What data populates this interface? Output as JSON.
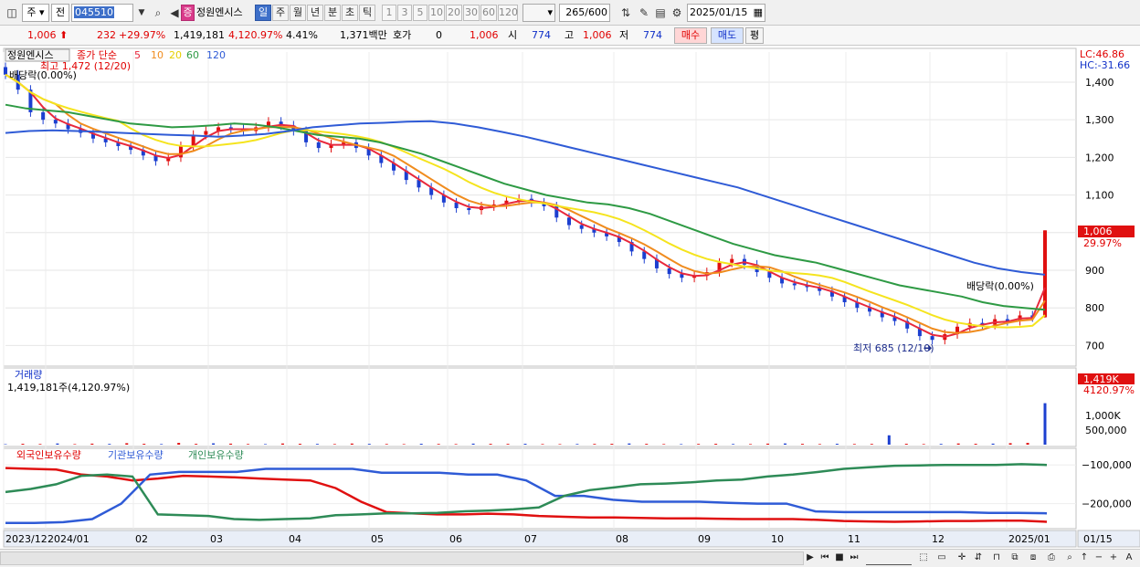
{
  "toolbar": {
    "market_dropdown": "주",
    "prev_dropdown": "전",
    "code_value": "045510",
    "stock_name": "정원엔시스",
    "badge": "증",
    "periods": [
      "일",
      "주",
      "월",
      "년",
      "분",
      "초",
      "틱"
    ],
    "active_period": "일",
    "intervals": [
      "1",
      "3",
      "5",
      "10",
      "20",
      "30",
      "60",
      "120"
    ],
    "count": "265",
    "count_total": "/600",
    "date": "2025/01/15"
  },
  "quote": {
    "price": "1,006",
    "change": "232",
    "change_rate": "+29.97%",
    "volume": "1,419,181",
    "volume_rate": "4,120.97%",
    "turnover_rate": "4.41%",
    "trade_value": "1,371백만",
    "hoga_label": "호가",
    "hoga_value": "0",
    "hoga_price": "1,006",
    "open_label": "시",
    "open": "774",
    "high_label": "고",
    "high": "1,006",
    "low_label": "저",
    "low": "774",
    "buy_label": "매수",
    "sell_label": "매도",
    "avg_label": "평"
  },
  "price_panel": {
    "title": "정원엔시스",
    "ma_label": "종가 단순",
    "ma_periods": [
      "5",
      "10",
      "20",
      "60",
      "120"
    ],
    "high_marker": "최고 1,472 (12/20)",
    "dividend_top": "배당락(0.00%)",
    "dividend_right": "배당락(0.00%)",
    "low_marker": "최저 685 (12/10)",
    "lc": "LC:46.86",
    "hc": "HC:-31.66",
    "last_price_tag": "1,006",
    "last_change_tag": "29.97%"
  },
  "volume_panel": {
    "title": "거래량",
    "subtitle": "1,419,181주(4,120.97%)",
    "tag": "1,419K",
    "tag_sub": "4120.97%"
  },
  "holding_panel": {
    "legend": [
      "외국인보유수량",
      "기관보유수량",
      "개인보유수량"
    ]
  },
  "chart_data": [
    {
      "type": "candlestick",
      "title": "정원엔시스",
      "x": [
        "2023/12",
        "2024/01",
        "02",
        "03",
        "04",
        "05",
        "06",
        "07",
        "08",
        "09",
        "10",
        "11",
        "12",
        "2025/01",
        "01/15"
      ],
      "ylim": [
        650,
        1480
      ],
      "y_ticks": [
        "1,400",
        "1,300",
        "1,200",
        "1,100",
        "1,000",
        "900",
        "800",
        "700"
      ],
      "close": [
        1420,
        1380,
        1320,
        1300,
        1290,
        1275,
        1265,
        1250,
        1240,
        1230,
        1220,
        1205,
        1190,
        1200,
        1230,
        1260,
        1270,
        1280,
        1275,
        1270,
        1280,
        1295,
        1285,
        1270,
        1240,
        1225,
        1235,
        1240,
        1225,
        1205,
        1185,
        1165,
        1140,
        1120,
        1100,
        1080,
        1065,
        1060,
        1070,
        1075,
        1085,
        1090,
        1080,
        1070,
        1040,
        1020,
        1010,
        1000,
        990,
        975,
        950,
        930,
        905,
        890,
        880,
        885,
        895,
        920,
        930,
        915,
        895,
        880,
        865,
        860,
        855,
        845,
        830,
        815,
        800,
        790,
        775,
        765,
        745,
        725,
        715,
        730,
        750,
        760,
        755,
        770,
        765,
        780,
        775,
        1006
      ],
      "series": [
        {
          "name": "5",
          "color": "#e8283c"
        },
        {
          "name": "10",
          "color": "#f08c1e"
        },
        {
          "name": "20",
          "color": "#f5e41e"
        },
        {
          "name": "60",
          "color": "#2e9a44",
          "values": [
            1340,
            1330,
            1325,
            1320,
            1310,
            1300,
            1290,
            1285,
            1280,
            1282,
            1285,
            1290,
            1287,
            1280,
            1270,
            1260,
            1255,
            1250,
            1240,
            1225,
            1210,
            1190,
            1170,
            1150,
            1130,
            1115,
            1100,
            1090,
            1080,
            1075,
            1065,
            1050,
            1030,
            1010,
            990,
            970,
            955,
            940,
            930,
            920,
            905,
            890,
            875,
            860,
            850,
            840,
            830,
            815,
            805,
            800,
            795
          ]
        },
        {
          "name": "120",
          "color": "#2f5bd6",
          "values": [
            1265,
            1270,
            1272,
            1270,
            1268,
            1265,
            1262,
            1260,
            1258,
            1255,
            1258,
            1262,
            1270,
            1280,
            1285,
            1290,
            1292,
            1295,
            1296,
            1290,
            1280,
            1268,
            1255,
            1240,
            1225,
            1210,
            1195,
            1180,
            1165,
            1150,
            1135,
            1120,
            1100,
            1080,
            1060,
            1040,
            1020,
            1000,
            980,
            960,
            940,
            920,
            905,
            895,
            888
          ]
        }
      ]
    },
    {
      "type": "bar",
      "title": "거래량",
      "ylim": [
        0,
        1500000
      ],
      "y_ticks": [
        "1,000K",
        "500,000"
      ],
      "values": [
        15000,
        30000,
        22000,
        40000,
        18000,
        35000,
        25000,
        50000,
        30000,
        20000,
        60000,
        28000,
        45000,
        35000,
        22000,
        18000,
        40000,
        30000,
        25000,
        20000,
        38000,
        26000,
        22000,
        18000,
        30000,
        24000,
        20000,
        35000,
        28000,
        26000,
        30000,
        20000,
        18000,
        22000,
        25000,
        30000,
        40000,
        28000,
        20000,
        18000,
        25000,
        30000,
        22000,
        20000,
        35000,
        40000,
        28000,
        20000,
        30000,
        22000,
        25000,
        320000,
        30000,
        20000,
        25000,
        40000,
        30000,
        35000,
        50000,
        60000,
        1419181
      ]
    },
    {
      "type": "line",
      "title": "투자자별 보유수량",
      "ylim": [
        -260000,
        -90000
      ],
      "y_ticks": [
        "-100,000",
        "-200,000"
      ],
      "series": [
        {
          "name": "외국인보유수량",
          "color": "#e01010",
          "values": [
            -108000,
            -110000,
            -112000,
            -125000,
            -130000,
            -140000,
            -135000,
            -128000,
            -130000,
            -132000,
            -135000,
            -138000,
            -140000,
            -160000,
            -195000,
            -222000,
            -225000,
            -228000,
            -228000,
            -226000,
            -228000,
            -232000,
            -234000,
            -236000,
            -236000,
            -237000,
            -238000,
            -238000,
            -239000,
            -240000,
            -240000,
            -240000,
            -242000,
            -245000,
            -246000,
            -247000,
            -246000,
            -245000,
            -245000,
            -244000,
            -244000,
            -247000
          ]
        },
        {
          "name": "기관보유수량",
          "color": "#2f5bd6",
          "values": [
            -250000,
            -250000,
            -248000,
            -240000,
            -200000,
            -125000,
            -118000,
            -118000,
            -118000,
            -110000,
            -110000,
            -110000,
            -110000,
            -120000,
            -120000,
            -120000,
            -125000,
            -125000,
            -140000,
            -180000,
            -180000,
            -190000,
            -195000,
            -195000,
            -195000,
            -198000,
            -200000,
            -200000,
            -220000,
            -222000,
            -222000,
            -222000,
            -222000,
            -222000,
            -224000,
            -224000,
            -225000
          ]
        },
        {
          "name": "개인보유수량",
          "color": "#2e8b57",
          "values": [
            -170000,
            -162000,
            -150000,
            -128000,
            -125000,
            -130000,
            -228000,
            -230000,
            -232000,
            -240000,
            -242000,
            -240000,
            -238000,
            -230000,
            -228000,
            -225000,
            -225000,
            -224000,
            -220000,
            -218000,
            -215000,
            -210000,
            -180000,
            -165000,
            -158000,
            -150000,
            -148000,
            -145000,
            -140000,
            -138000,
            -130000,
            -125000,
            -118000,
            -110000,
            -106000,
            -102000,
            -101000,
            -100000,
            -100000,
            -100000,
            -98000,
            -100000
          ]
        }
      ]
    }
  ]
}
